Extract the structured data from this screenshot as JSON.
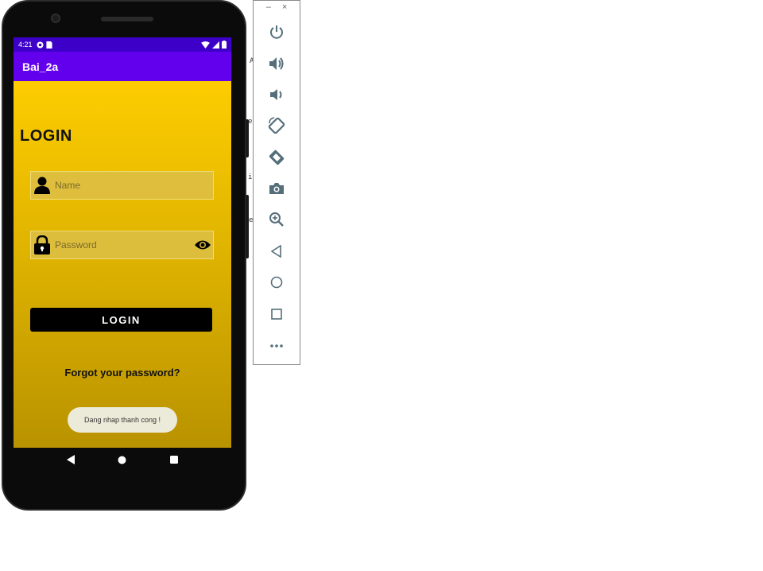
{
  "status_bar": {
    "time": "4:21"
  },
  "app_bar": {
    "title": "Bai_2a"
  },
  "login": {
    "heading": "LOGIN",
    "name_placeholder": "Name",
    "password_placeholder": "Password",
    "button_label": "LOGIN",
    "forgot_link": "Forgot your password?"
  },
  "toast": {
    "message": "Dang nhap thanh cong !"
  },
  "emulator_toolbar": {
    "minimize_label": "–",
    "close_label": "×",
    "buttons": [
      "power-icon",
      "volume-up-icon",
      "volume-down-icon",
      "rotate-left-icon",
      "rotate-right-icon",
      "camera-icon",
      "zoom-icon",
      "back-icon",
      "home-icon",
      "overview-icon",
      "more-icon"
    ]
  },
  "colors": {
    "status_bar": "#3d00c9",
    "app_bar": "#6200ee",
    "gradient_top": "#fdcd00",
    "gradient_bottom": "#b99300",
    "toast_bg": "#ecead8",
    "toolbar_icon": "#546e7a"
  }
}
